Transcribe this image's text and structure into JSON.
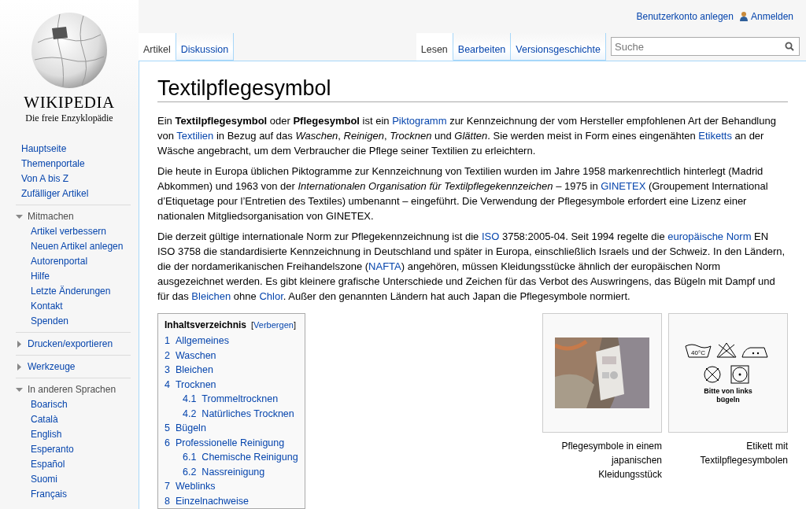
{
  "logo": {
    "wordmark": "WIKIPEDIA",
    "tagline": "Die freie Enzyklopädie"
  },
  "personal_tools": [
    "Benutzerkonto anlegen",
    "Anmelden"
  ],
  "sidebar": {
    "navigation": [
      "Hauptseite",
      "Themenportale",
      "Von A bis Z",
      "Zufälliger Artikel"
    ],
    "sections": [
      {
        "title": "Mitmachen",
        "expanded": true,
        "items": [
          "Artikel verbessern",
          "Neuen Artikel anlegen",
          "Autorenportal",
          "Hilfe",
          "Letzte Änderungen",
          "Kontakt",
          "Spenden"
        ]
      },
      {
        "title": "Drucken/exportieren",
        "expanded": false
      },
      {
        "title": "Werkzeuge",
        "expanded": false
      },
      {
        "title": "In anderen Sprachen",
        "expanded": true,
        "items": [
          "Boarisch",
          "Català",
          "English",
          "Esperanto",
          "Español",
          "Suomi",
          "Français"
        ]
      }
    ]
  },
  "namespace_tabs": [
    {
      "label": "Artikel",
      "selected": true
    },
    {
      "label": "Diskussion",
      "selected": false
    }
  ],
  "view_tabs": [
    {
      "label": "Lesen",
      "selected": true
    },
    {
      "label": "Bearbeiten",
      "selected": false
    },
    {
      "label": "Versionsgeschichte",
      "selected": false
    }
  ],
  "search": {
    "placeholder": "Suche"
  },
  "article": {
    "title": "Textilpflegesymbol",
    "paragraphs": [
      [
        {
          "kind": "text",
          "text": "Ein **Textilpflegesymbol** oder **Pflegesymbol** ist ein "
        },
        {
          "kind": "link",
          "text": "Piktogramm"
        },
        {
          "kind": "text",
          "text": " zur Kennzeichnung der vom Hersteller empfohlenen Art der Behandlung von "
        },
        {
          "kind": "link",
          "text": "Textilien"
        },
        {
          "kind": "text",
          "text": " in Bezug auf das *Waschen*, *Reinigen*, *Trocknen* und *Glätten*. Sie werden meist in Form eines eingenähten "
        },
        {
          "kind": "link",
          "text": "Etiketts"
        },
        {
          "kind": "text",
          "text": " an der Wäsche angebracht, um dem Verbraucher die Pflege seiner Textilien zu erleichtern."
        }
      ],
      [
        {
          "kind": "text",
          "text": "Die heute in Europa üblichen Piktogramme zur Kennzeichnung von Textilien wurden im Jahre 1958 markenrechtlich hinterlegt (Madrid Abkommen) und 1963 von der *Internationalen Organisation für Textilpflegekennzeichen* – 1975 in "
        },
        {
          "kind": "link",
          "text": "GINETEX"
        },
        {
          "kind": "text",
          "text": " (Groupement International d’Etiquetage pour l’Entretien des Textiles) umbenannt – eingeführt. Die Verwendung der Pflegesymbole erfordert eine Lizenz einer nationalen Mitgliedsorganisation von GINETEX."
        }
      ],
      [
        {
          "kind": "text",
          "text": "Die derzeit gültige internationale Norm zur Pflegekennzeichnung ist die "
        },
        {
          "kind": "link",
          "text": "ISO"
        },
        {
          "kind": "text",
          "text": " 3758:2005-04. Seit 1994 regelte die "
        },
        {
          "kind": "link",
          "text": "europäische Norm"
        },
        {
          "kind": "text",
          "text": " EN ISO 3758 die standardisierte Kennzeichnung in Deutschland und später in Europa, einschließlich Israels und der Schweiz. In den Ländern, die der nordamerikanischen Freihandelszone ("
        },
        {
          "kind": "link",
          "text": "NAFTA"
        },
        {
          "kind": "text",
          "text": ") angehören, müssen Kleidungsstücke ähnlich der europäischen Norm ausgezeichnet werden. Es gibt kleinere grafische Unterschiede und Zeichen für das Verbot des Auswringens, das Bügeln mit Dampf und für das "
        },
        {
          "kind": "link",
          "text": "Bleichen"
        },
        {
          "kind": "text",
          "text": " ohne "
        },
        {
          "kind": "link",
          "text": "Chlor"
        },
        {
          "kind": "text",
          "text": ". Außer den genannten Ländern hat auch Japan die Pflegesymbole normiert."
        }
      ]
    ]
  },
  "toc": {
    "title": "Inhaltsverzeichnis",
    "toggle_open": "[",
    "toggle": "Verbergen",
    "toggle_close": "]",
    "items": [
      {
        "number": "1",
        "text": "Allgemeines"
      },
      {
        "number": "2",
        "text": "Waschen"
      },
      {
        "number": "3",
        "text": "Bleichen"
      },
      {
        "number": "4",
        "text": "Trocknen",
        "children": [
          {
            "number": "4.1",
            "text": "Trommeltrocknen"
          },
          {
            "number": "4.2",
            "text": "Natürliches Trocknen"
          }
        ]
      },
      {
        "number": "5",
        "text": "Bügeln"
      },
      {
        "number": "6",
        "text": "Professionelle Reinigung",
        "children": [
          {
            "number": "6.1",
            "text": "Chemische Reinigung"
          },
          {
            "number": "6.2",
            "text": "Nassreinigung"
          }
        ]
      },
      {
        "number": "7",
        "text": "Weblinks"
      },
      {
        "number": "8",
        "text": "Einzelnachweise"
      }
    ]
  },
  "figures": [
    {
      "kind": "picture",
      "caption": "Pflegesymbole in einem japanischen Kleidungsstück"
    },
    {
      "kind": "symbols",
      "temperature": "40°C",
      "note": "Bitte von links bügeln",
      "caption": "Etikett mit Textilpflegesymbolen"
    }
  ]
}
